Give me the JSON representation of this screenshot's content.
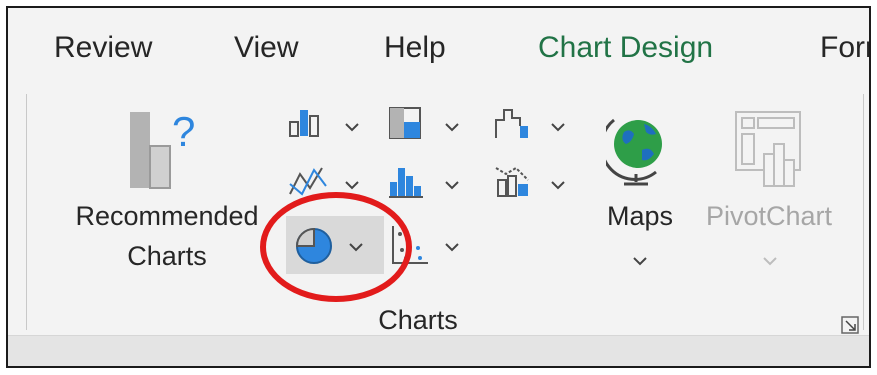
{
  "tabs": [
    {
      "label": "Review",
      "active": false
    },
    {
      "label": "View",
      "active": false
    },
    {
      "label": "Help",
      "active": false
    },
    {
      "label": "Chart Design",
      "active": true
    },
    {
      "label": "Forr",
      "active": false
    }
  ],
  "ribbon": {
    "recommended_charts": {
      "line1": "Recommended",
      "line2": "Charts"
    },
    "maps": {
      "label": "Maps"
    },
    "pivotchart": {
      "label": "PivotChart",
      "disabled": true
    },
    "group_label": "Charts"
  },
  "icons": {
    "recommended": "bar-chart-question-icon",
    "column": "column-chart-icon",
    "hierarchy": "treemap-chart-icon",
    "waterfall": "waterfall-chart-icon",
    "line": "line-chart-icon",
    "statistic": "histogram-chart-icon",
    "combo": "combo-chart-icon",
    "pie": "pie-chart-icon",
    "scatter": "scatter-chart-icon",
    "maps": "globe-icon",
    "pivotchart": "pivotchart-icon",
    "launcher": "dialog-launcher-icon"
  },
  "colors": {
    "active_tab": "#217346",
    "highlight_ring": "#e21b1b",
    "chart_blue": "#2e86de"
  }
}
